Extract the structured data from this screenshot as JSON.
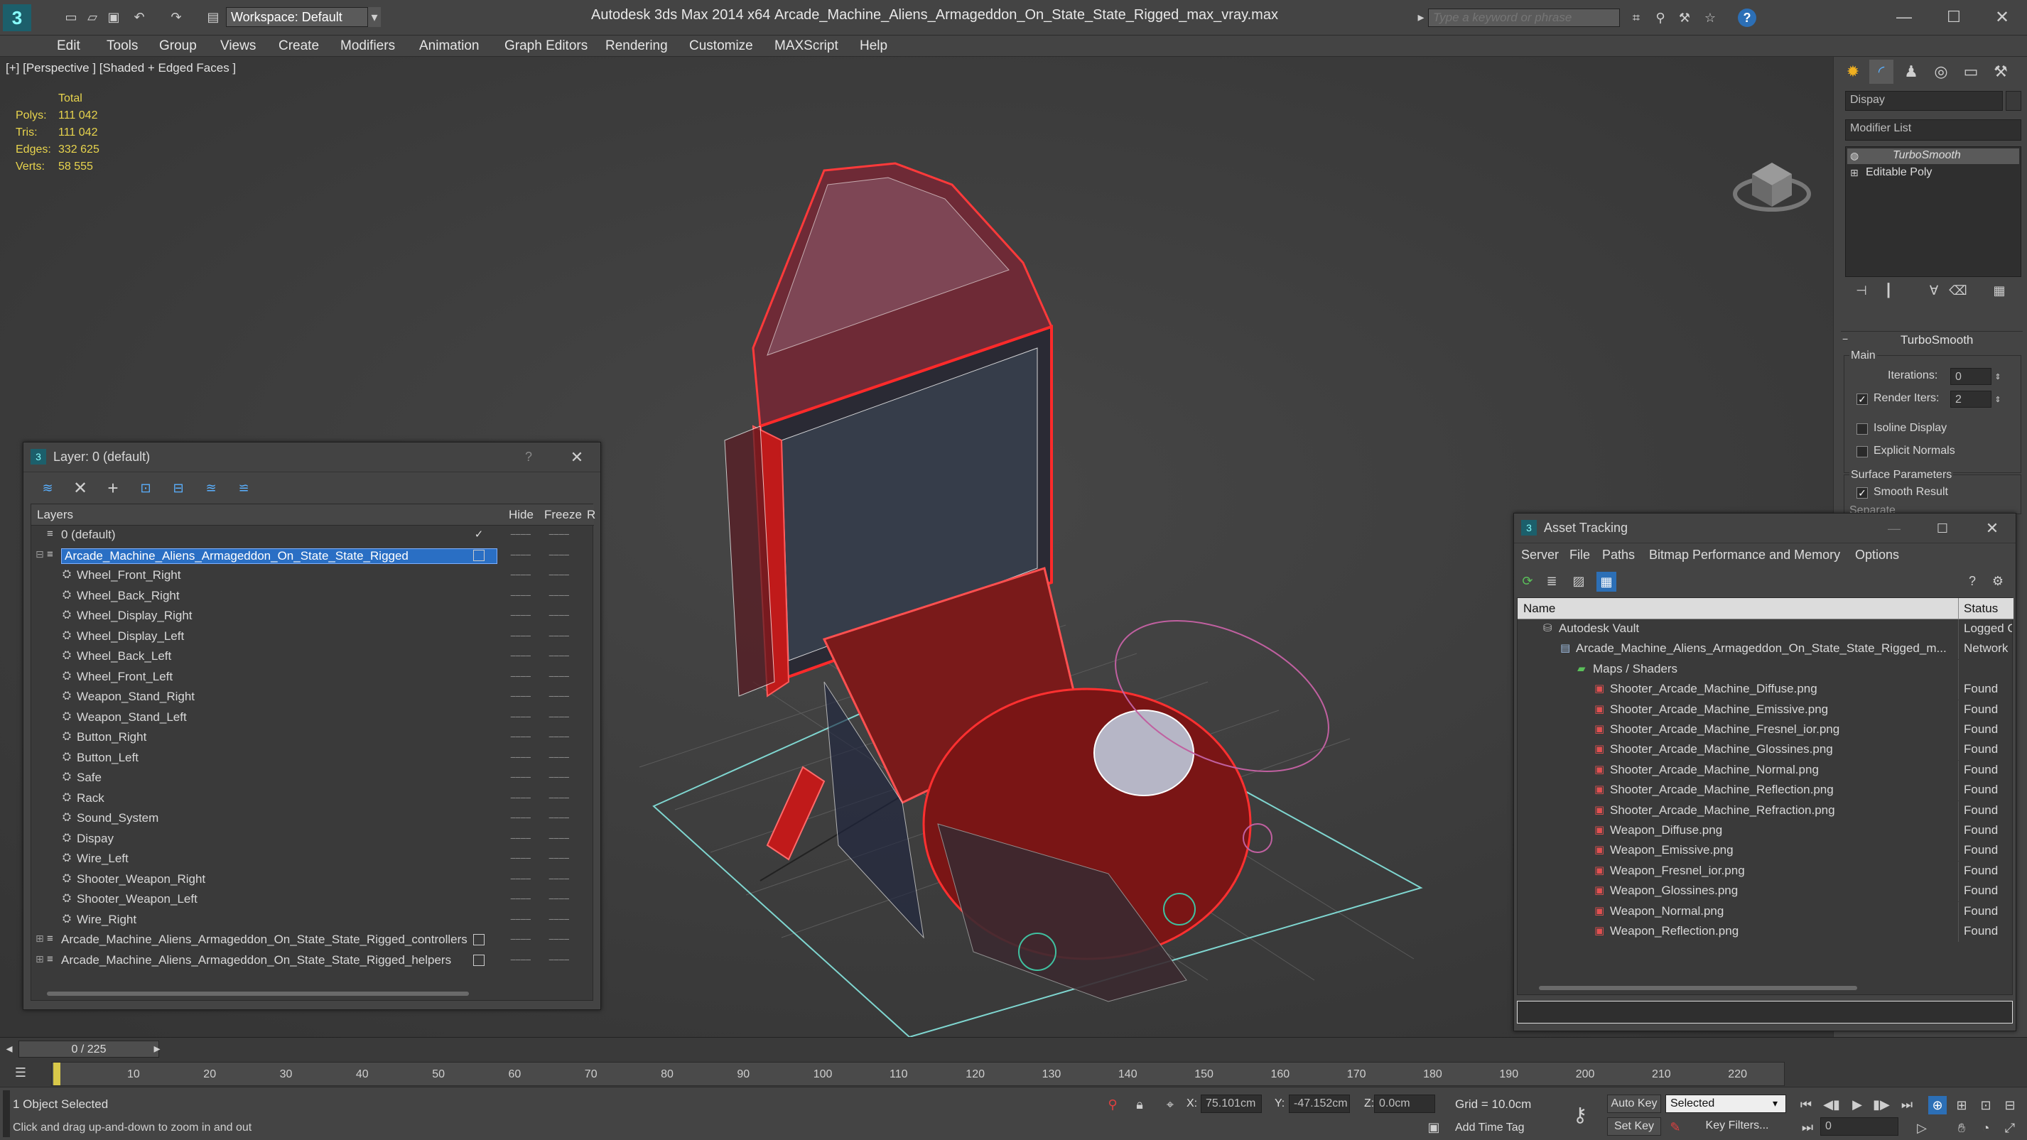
{
  "titlebar": {
    "workspace_label": "Workspace: Default",
    "app_title": "Autodesk 3ds Max  2014 x64",
    "file_name": "Arcade_Machine_Aliens_Armageddon_On_State_State_Rigged_max_vray.max",
    "search_placeholder": "Type a keyword or phrase"
  },
  "menu": [
    "Edit",
    "Tools",
    "Group",
    "Views",
    "Create",
    "Modifiers",
    "Animation",
    "Graph Editors",
    "Rendering",
    "Customize",
    "MAXScript",
    "Help"
  ],
  "viewport": {
    "label": "[+] [Perspective ] [Shaded + Edged Faces ]",
    "stats": {
      "header": "Total",
      "rows": [
        {
          "k": "Polys:",
          "v": "111 042"
        },
        {
          "k": "Tris:",
          "v": "111 042"
        },
        {
          "k": "Edges:",
          "v": "332 625"
        },
        {
          "k": "Verts:",
          "v": "58 555"
        }
      ]
    }
  },
  "command_panel": {
    "object_name": "Dispay",
    "modifier_list": "Modifier List",
    "stack": [
      "TurboSmooth",
      "Editable Poly"
    ],
    "rollout_title": "TurboSmooth",
    "group_main": "Main",
    "iterations_label": "Iterations:",
    "iterations_value": "0",
    "render_iters_label": "Render Iters:",
    "render_iters_value": "2",
    "isoline_label": "Isoline Display",
    "explicit_label": "Explicit Normals",
    "surface_label": "Surface Parameters",
    "smooth_label": "Smooth Result",
    "separate_label": "Separate"
  },
  "layer_window": {
    "title": "Layer: 0 (default)",
    "help": "?",
    "col_layers": "Layers",
    "col_hide": "Hide",
    "col_freeze": "Freeze",
    "col_r": "R",
    "rows": [
      {
        "name": "0 (default)",
        "level": 0,
        "type": "layer"
      },
      {
        "name": "Arcade_Machine_Aliens_Armageddon_On_State_State_Rigged",
        "level": 0,
        "type": "layer",
        "selected": true
      },
      {
        "name": "Wheel_Front_Right",
        "level": 1
      },
      {
        "name": "Wheel_Back_Right",
        "level": 1
      },
      {
        "name": "Wheel_Display_Right",
        "level": 1
      },
      {
        "name": "Wheel_Display_Left",
        "level": 1
      },
      {
        "name": "Wheel_Back_Left",
        "level": 1
      },
      {
        "name": "Wheel_Front_Left",
        "level": 1
      },
      {
        "name": "Weapon_Stand_Right",
        "level": 1
      },
      {
        "name": "Weapon_Stand_Left",
        "level": 1
      },
      {
        "name": "Button_Right",
        "level": 1
      },
      {
        "name": "Button_Left",
        "level": 1
      },
      {
        "name": "Safe",
        "level": 1
      },
      {
        "name": "Rack",
        "level": 1
      },
      {
        "name": "Sound_System",
        "level": 1
      },
      {
        "name": "Dispay",
        "level": 1
      },
      {
        "name": "Wire_Left",
        "level": 1
      },
      {
        "name": "Shooter_Weapon_Right",
        "level": 1
      },
      {
        "name": "Shooter_Weapon_Left",
        "level": 1
      },
      {
        "name": "Wire_Right",
        "level": 1
      },
      {
        "name": "Arcade_Machine_Aliens_Armageddon_On_State_State_Rigged_controllers",
        "level": 0,
        "type": "layer"
      },
      {
        "name": "Arcade_Machine_Aliens_Armageddon_On_State_State_Rigged_helpers",
        "level": 0,
        "type": "layer"
      }
    ]
  },
  "asset_window": {
    "title": "Asset Tracking",
    "menu": [
      "Server",
      "File",
      "Paths",
      "Bitmap Performance and Memory",
      "Options"
    ],
    "col_name": "Name",
    "col_status": "Status",
    "rows": [
      {
        "name": "Autodesk Vault",
        "status": "Logged O",
        "level": 0
      },
      {
        "name": "Arcade_Machine_Aliens_Armageddon_On_State_State_Rigged_m...",
        "status": "Network I",
        "level": 1
      },
      {
        "name": "Maps / Shaders",
        "status": "",
        "level": 2
      },
      {
        "name": "Shooter_Arcade_Machine_Diffuse.png",
        "status": "Found",
        "level": 3
      },
      {
        "name": "Shooter_Arcade_Machine_Emissive.png",
        "status": "Found",
        "level": 3
      },
      {
        "name": "Shooter_Arcade_Machine_Fresnel_ior.png",
        "status": "Found",
        "level": 3
      },
      {
        "name": "Shooter_Arcade_Machine_Glossines.png",
        "status": "Found",
        "level": 3
      },
      {
        "name": "Shooter_Arcade_Machine_Normal.png",
        "status": "Found",
        "level": 3
      },
      {
        "name": "Shooter_Arcade_Machine_Reflection.png",
        "status": "Found",
        "level": 3
      },
      {
        "name": "Shooter_Arcade_Machine_Refraction.png",
        "status": "Found",
        "level": 3
      },
      {
        "name": "Weapon_Diffuse.png",
        "status": "Found",
        "level": 3
      },
      {
        "name": "Weapon_Emissive.png",
        "status": "Found",
        "level": 3
      },
      {
        "name": "Weapon_Fresnel_ior.png",
        "status": "Found",
        "level": 3
      },
      {
        "name": "Weapon_Glossines.png",
        "status": "Found",
        "level": 3
      },
      {
        "name": "Weapon_Normal.png",
        "status": "Found",
        "level": 3
      },
      {
        "name": "Weapon_Reflection.png",
        "status": "Found",
        "level": 3
      }
    ]
  },
  "timeline": {
    "frame_counter": "0 / 225",
    "ticks": [
      "10",
      "20",
      "30",
      "40",
      "50",
      "60",
      "70",
      "80",
      "90",
      "100",
      "110",
      "120",
      "130",
      "140",
      "150",
      "160",
      "170",
      "180",
      "190",
      "200",
      "210",
      "220"
    ]
  },
  "status": {
    "selection": "1 Object Selected",
    "prompt": "Click and drag up-and-down to zoom in and out",
    "x_label": "X:",
    "x_value": "75.101cm",
    "y_label": "Y:",
    "y_value": "-47.152cm",
    "z_label": "Z:",
    "z_value": "0.0cm",
    "grid": "Grid = 10.0cm",
    "add_time_tag": "Add Time Tag",
    "auto_key": "Auto Key",
    "set_key": "Set Key",
    "selected_dropdown": "Selected",
    "key_filters": "Key Filters...",
    "current_frame": "0"
  },
  "colors": {
    "accent_selection": "#2a6fc4",
    "stats_yellow": "#e8d44d",
    "wire_red": "#ff2a2a",
    "grid_cyan": "#7fd6d0"
  }
}
